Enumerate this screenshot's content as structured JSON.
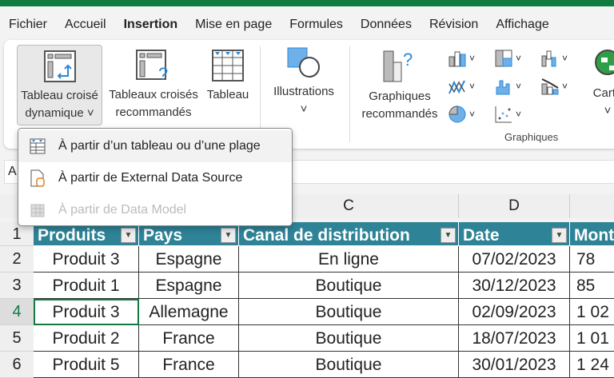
{
  "tabs": [
    "Fichier",
    "Accueil",
    "Insertion",
    "Mise en page",
    "Formules",
    "Données",
    "Révision",
    "Affichage"
  ],
  "active_tab": "Insertion",
  "ribbon": {
    "pivot": {
      "line1": "Tableau croisé",
      "line2": "dynamique"
    },
    "rec_pivot": {
      "line1": "Tableaux croisés",
      "line2": "recommandés"
    },
    "table": "Tableau",
    "illustrations": "Illustrations",
    "rec_charts": {
      "line1": "Graphiques",
      "line2": "recommandés"
    },
    "charts_group": "Graphiques",
    "maps": "Carte"
  },
  "menu": [
    {
      "label": "À partir d’un tableau ou d’une plage",
      "disabled": false
    },
    {
      "label": "À partir de External Data Source",
      "disabled": false
    },
    {
      "label": "À partir de Data Model",
      "disabled": true
    }
  ],
  "namebox": "A",
  "columns": [
    "C",
    "D"
  ],
  "headers": [
    "Produits",
    "Pays",
    "Canal de distribution",
    "Date",
    "Mont"
  ],
  "rows": [
    {
      "n": "1"
    },
    {
      "n": "2",
      "cells": [
        "Produit 3",
        "Espagne",
        "En ligne",
        "07/02/2023",
        "78"
      ]
    },
    {
      "n": "3",
      "cells": [
        "Produit 1",
        "Espagne",
        "Boutique",
        "30/12/2023",
        "85"
      ]
    },
    {
      "n": "4",
      "cells": [
        "Produit 3",
        "Allemagne",
        "Boutique",
        "02/09/2023",
        "1 02"
      ]
    },
    {
      "n": "5",
      "cells": [
        "Produit 2",
        "France",
        "Boutique",
        "18/07/2023",
        "1 01"
      ]
    },
    {
      "n": "6",
      "cells": [
        "Produit 5",
        "France",
        "Boutique",
        "30/01/2023",
        "1 24"
      ]
    }
  ],
  "colors": {
    "accent": "#107c41",
    "table_header": "#2e8397"
  }
}
